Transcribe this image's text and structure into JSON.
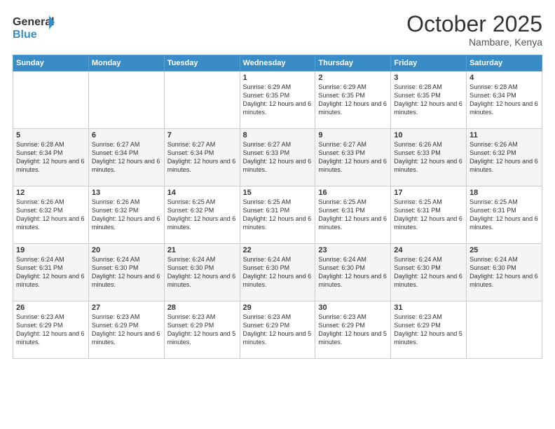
{
  "header": {
    "logo_line1": "General",
    "logo_line2": "Blue",
    "month": "October 2025",
    "location": "Nambare, Kenya"
  },
  "days_of_week": [
    "Sunday",
    "Monday",
    "Tuesday",
    "Wednesday",
    "Thursday",
    "Friday",
    "Saturday"
  ],
  "weeks": [
    [
      {
        "day": "",
        "info": ""
      },
      {
        "day": "",
        "info": ""
      },
      {
        "day": "",
        "info": ""
      },
      {
        "day": "1",
        "info": "Sunrise: 6:29 AM\nSunset: 6:35 PM\nDaylight: 12 hours and 6 minutes."
      },
      {
        "day": "2",
        "info": "Sunrise: 6:29 AM\nSunset: 6:35 PM\nDaylight: 12 hours and 6 minutes."
      },
      {
        "day": "3",
        "info": "Sunrise: 6:28 AM\nSunset: 6:35 PM\nDaylight: 12 hours and 6 minutes."
      },
      {
        "day": "4",
        "info": "Sunrise: 6:28 AM\nSunset: 6:34 PM\nDaylight: 12 hours and 6 minutes."
      }
    ],
    [
      {
        "day": "5",
        "info": "Sunrise: 6:28 AM\nSunset: 6:34 PM\nDaylight: 12 hours and 6 minutes."
      },
      {
        "day": "6",
        "info": "Sunrise: 6:27 AM\nSunset: 6:34 PM\nDaylight: 12 hours and 6 minutes."
      },
      {
        "day": "7",
        "info": "Sunrise: 6:27 AM\nSunset: 6:34 PM\nDaylight: 12 hours and 6 minutes."
      },
      {
        "day": "8",
        "info": "Sunrise: 6:27 AM\nSunset: 6:33 PM\nDaylight: 12 hours and 6 minutes."
      },
      {
        "day": "9",
        "info": "Sunrise: 6:27 AM\nSunset: 6:33 PM\nDaylight: 12 hours and 6 minutes."
      },
      {
        "day": "10",
        "info": "Sunrise: 6:26 AM\nSunset: 6:33 PM\nDaylight: 12 hours and 6 minutes."
      },
      {
        "day": "11",
        "info": "Sunrise: 6:26 AM\nSunset: 6:32 PM\nDaylight: 12 hours and 6 minutes."
      }
    ],
    [
      {
        "day": "12",
        "info": "Sunrise: 6:26 AM\nSunset: 6:32 PM\nDaylight: 12 hours and 6 minutes."
      },
      {
        "day": "13",
        "info": "Sunrise: 6:26 AM\nSunset: 6:32 PM\nDaylight: 12 hours and 6 minutes."
      },
      {
        "day": "14",
        "info": "Sunrise: 6:25 AM\nSunset: 6:32 PM\nDaylight: 12 hours and 6 minutes."
      },
      {
        "day": "15",
        "info": "Sunrise: 6:25 AM\nSunset: 6:31 PM\nDaylight: 12 hours and 6 minutes."
      },
      {
        "day": "16",
        "info": "Sunrise: 6:25 AM\nSunset: 6:31 PM\nDaylight: 12 hours and 6 minutes."
      },
      {
        "day": "17",
        "info": "Sunrise: 6:25 AM\nSunset: 6:31 PM\nDaylight: 12 hours and 6 minutes."
      },
      {
        "day": "18",
        "info": "Sunrise: 6:25 AM\nSunset: 6:31 PM\nDaylight: 12 hours and 6 minutes."
      }
    ],
    [
      {
        "day": "19",
        "info": "Sunrise: 6:24 AM\nSunset: 6:31 PM\nDaylight: 12 hours and 6 minutes."
      },
      {
        "day": "20",
        "info": "Sunrise: 6:24 AM\nSunset: 6:30 PM\nDaylight: 12 hours and 6 minutes."
      },
      {
        "day": "21",
        "info": "Sunrise: 6:24 AM\nSunset: 6:30 PM\nDaylight: 12 hours and 6 minutes."
      },
      {
        "day": "22",
        "info": "Sunrise: 6:24 AM\nSunset: 6:30 PM\nDaylight: 12 hours and 6 minutes."
      },
      {
        "day": "23",
        "info": "Sunrise: 6:24 AM\nSunset: 6:30 PM\nDaylight: 12 hours and 6 minutes."
      },
      {
        "day": "24",
        "info": "Sunrise: 6:24 AM\nSunset: 6:30 PM\nDaylight: 12 hours and 6 minutes."
      },
      {
        "day": "25",
        "info": "Sunrise: 6:24 AM\nSunset: 6:30 PM\nDaylight: 12 hours and 6 minutes."
      }
    ],
    [
      {
        "day": "26",
        "info": "Sunrise: 6:23 AM\nSunset: 6:29 PM\nDaylight: 12 hours and 6 minutes."
      },
      {
        "day": "27",
        "info": "Sunrise: 6:23 AM\nSunset: 6:29 PM\nDaylight: 12 hours and 6 minutes."
      },
      {
        "day": "28",
        "info": "Sunrise: 6:23 AM\nSunset: 6:29 PM\nDaylight: 12 hours and 5 minutes."
      },
      {
        "day": "29",
        "info": "Sunrise: 6:23 AM\nSunset: 6:29 PM\nDaylight: 12 hours and 5 minutes."
      },
      {
        "day": "30",
        "info": "Sunrise: 6:23 AM\nSunset: 6:29 PM\nDaylight: 12 hours and 5 minutes."
      },
      {
        "day": "31",
        "info": "Sunrise: 6:23 AM\nSunset: 6:29 PM\nDaylight: 12 hours and 5 minutes."
      },
      {
        "day": "",
        "info": ""
      }
    ]
  ]
}
